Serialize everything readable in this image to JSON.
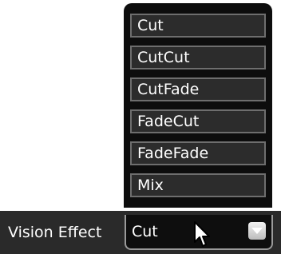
{
  "vision_effect": {
    "label": "Vision Effect",
    "selected_value": "Cut",
    "options": [
      "Cut",
      "CutCut",
      "CutFade",
      "FadeCut",
      "FadeFade",
      "Mix"
    ]
  },
  "icons": {
    "dropdown_button": "chevron-down-icon",
    "cursor": "mouse-pointer-icon"
  },
  "colors": {
    "bar_background": "#2a2a2a",
    "list_background": "#0d0d0d",
    "option_background": "#2c2c2c",
    "option_border": "#6e6e6e",
    "text": "#ffffff"
  }
}
